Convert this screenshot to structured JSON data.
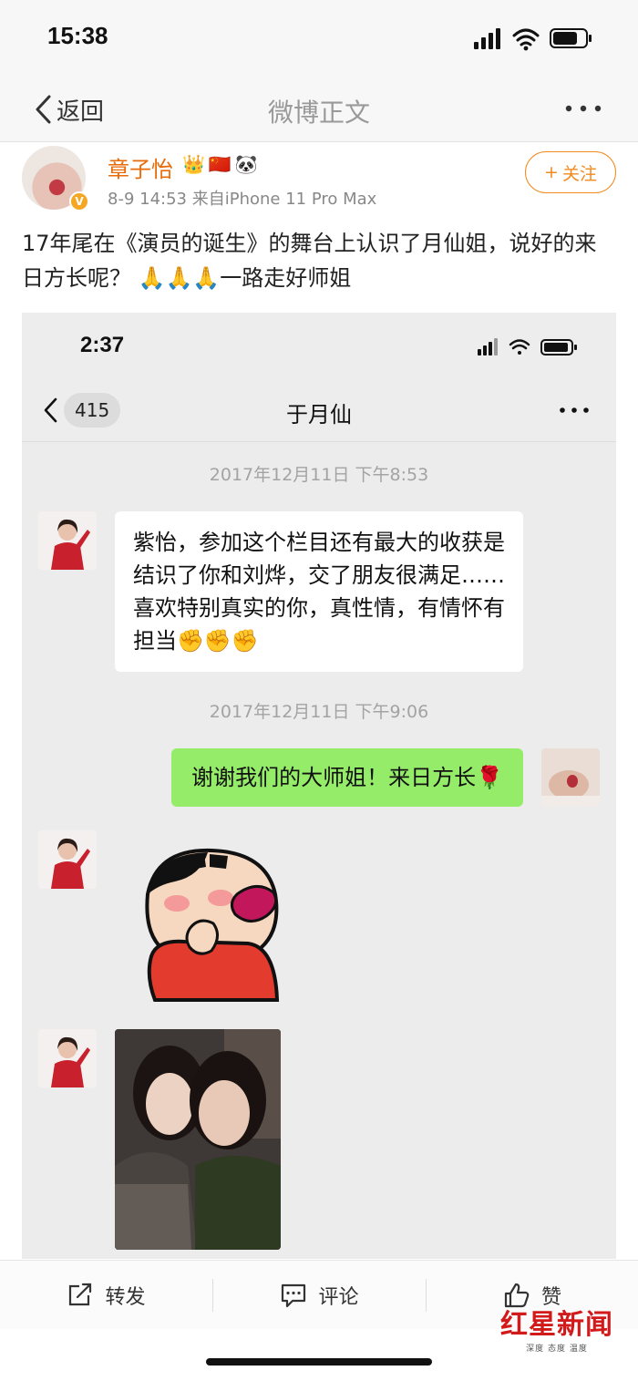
{
  "status_bar": {
    "time": "15:38"
  },
  "nav": {
    "back_label": "返回",
    "title": "微博正文"
  },
  "post": {
    "author": "章子怡",
    "badge_icons": [
      "👑",
      "🇨🇳",
      "🐼"
    ],
    "meta": "8-9 14:53  来自iPhone 11 Pro Max",
    "verified_icon": "v-badge-icon",
    "follow_label": "关注",
    "text": "17年尾在《演员的诞生》的舞台上认识了月仙姐，说好的来日方长呢？ 🙏🙏🙏一路走好师姐"
  },
  "screenshot": {
    "time": "2:37",
    "back_count": "415",
    "contact_name": "于月仙",
    "messages": [
      {
        "type": "time",
        "text": "2017年12月11日 下午8:53"
      },
      {
        "type": "left_text",
        "text": "紫怡，参加这个栏目还有最大的收获是结识了你和刘烨，交了朋友很满足……喜欢特别真实的你，真性情，有情怀有担当✊✊✊"
      },
      {
        "type": "time",
        "text": "2017年12月11日 下午9:06"
      },
      {
        "type": "right_text",
        "text": "谢谢我们的大师姐！来日方长🌹"
      },
      {
        "type": "left_sticker",
        "icon": "crayon-shin-chan-sticker"
      },
      {
        "type": "left_photo",
        "icon": "selfie-photo"
      }
    ]
  },
  "actions": {
    "repost": "转发",
    "comment": "评论",
    "like": "赞"
  },
  "watermark": {
    "main": "红星新闻",
    "sub": "深度 态度 温度"
  },
  "colors": {
    "accent": "#f28a1e",
    "author": "#e86b0a",
    "wechat_green": "#95ec69",
    "watermark_red": "#d21a1a"
  }
}
